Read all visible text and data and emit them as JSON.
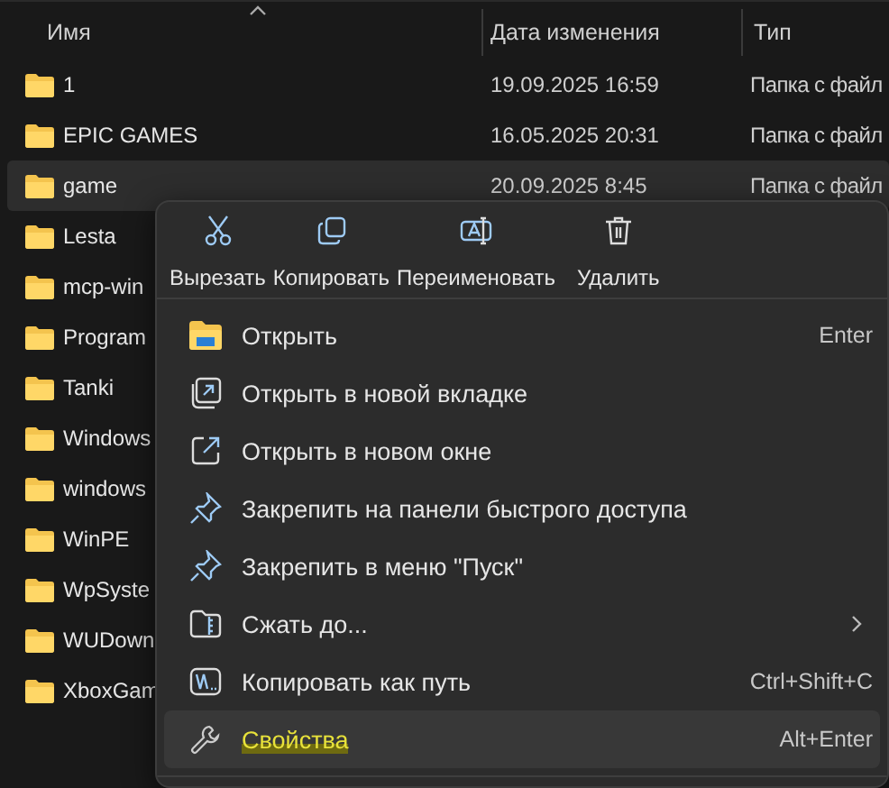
{
  "columns": [
    {
      "label": "Имя",
      "sorted": true
    },
    {
      "label": "Дата изменения",
      "sorted": false
    },
    {
      "label": "Тип",
      "sorted": false
    }
  ],
  "rows": [
    {
      "name": "1",
      "date": "19.09.2025 16:59",
      "type": "Папка с файл",
      "selected": false
    },
    {
      "name": "EPIC GAMES",
      "date": "16.05.2025 20:31",
      "type": "Папка с файл",
      "selected": false
    },
    {
      "name": "game",
      "date": "20.09.2025 8:45",
      "type": "Папка с файл",
      "selected": true
    },
    {
      "name": "Lesta",
      "selected": false
    },
    {
      "name": "mcp-win",
      "selected": false
    },
    {
      "name": "Program",
      "selected": false
    },
    {
      "name": "Tanki",
      "selected": false
    },
    {
      "name": "Windows",
      "selected": false
    },
    {
      "name": "windows",
      "selected": false
    },
    {
      "name": "WinPE",
      "selected": false
    },
    {
      "name": "WpSyste",
      "selected": false
    },
    {
      "name": "WUDown",
      "selected": false
    },
    {
      "name": "XboxGam",
      "selected": false
    }
  ],
  "context_menu": {
    "toolbar": [
      "Вырезать",
      "Копировать",
      "Переименовать",
      "Удалить"
    ],
    "items": [
      {
        "label": "Открыть",
        "shortcut": "Enter",
        "submenu": false,
        "hovered": false,
        "highlighter": false
      },
      {
        "label": "Открыть в новой вкладке",
        "submenu": false,
        "hovered": false,
        "highlighter": false
      },
      {
        "label": "Открыть в новом окне",
        "submenu": false,
        "hovered": false,
        "highlighter": false
      },
      {
        "label": "Закрепить на панели быстрого доступа",
        "submenu": false,
        "hovered": false,
        "highlighter": false
      },
      {
        "label": "Закрепить в меню \"Пуск\"",
        "submenu": false,
        "hovered": false,
        "highlighter": false
      },
      {
        "label": "Сжать до...",
        "submenu": true,
        "hovered": false,
        "highlighter": false
      },
      {
        "label": "Копировать как путь",
        "shortcut": "Ctrl+Shift+C",
        "submenu": false,
        "hovered": false,
        "highlighter": false
      },
      {
        "label": "Свойства",
        "shortcut": "Alt+Enter",
        "submenu": false,
        "hovered": true,
        "highlighter": true
      }
    ]
  }
}
